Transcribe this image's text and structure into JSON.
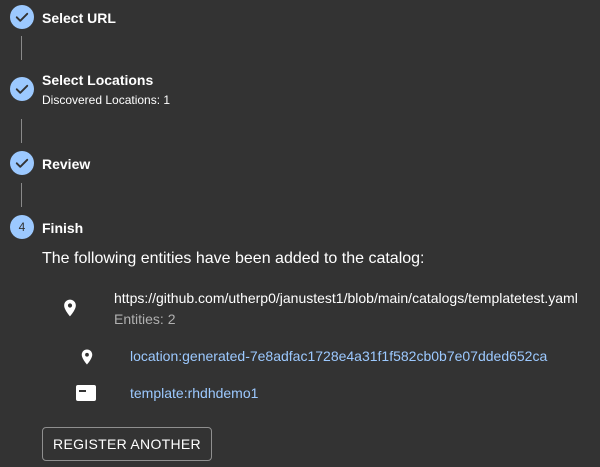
{
  "colors": {
    "background": "#333333",
    "step_completed": "#9cc9ff",
    "link": "#9cc9ff",
    "connector": "#8a8a8a",
    "text": "#ffffff",
    "muted_text": "#b0b0b0"
  },
  "stepper": {
    "steps": [
      {
        "title": "Select URL",
        "state": "completed",
        "icon": "check-icon"
      },
      {
        "title": "Select Locations",
        "subtitle": "Discovered Locations: 1",
        "state": "completed",
        "icon": "check-icon"
      },
      {
        "title": "Review",
        "state": "completed",
        "icon": "check-icon"
      },
      {
        "title": "Finish",
        "state": "active",
        "number": "4"
      }
    ]
  },
  "finish": {
    "heading": "The following entities have been added to the catalog:",
    "location": {
      "icon": "location-pin-icon",
      "url": "https://github.com/utherp0/janustest1/blob/main/catalogs/templatetest.yaml",
      "entities_count": "Entities: 2"
    },
    "entities": [
      {
        "icon": "location-pin-icon",
        "label": "location:generated-7e8adfac1728e4a31f1f582cb0b7e07dded652ca"
      },
      {
        "icon": "template-card-icon",
        "label": "template:rhdhdemo1"
      }
    ],
    "register_another_label": "REGISTER ANOTHER"
  }
}
